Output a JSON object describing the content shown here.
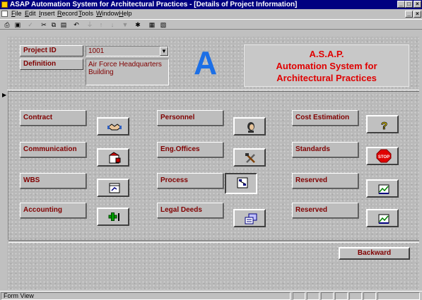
{
  "window": {
    "title": "ASAP Automation System for Architectural Practices - [Details of Project Information]",
    "min_glyph": "_",
    "max_glyph": "□",
    "close_glyph": "×"
  },
  "menu": [
    "File",
    "Edit",
    "Insert",
    "Record",
    "Tools",
    "Window",
    "Help"
  ],
  "toolbar": {
    "buttons": [
      {
        "name": "print-icon",
        "glyph": "⎙"
      },
      {
        "name": "preview-icon",
        "glyph": "▣"
      },
      {
        "name": "spell-icon",
        "glyph": "✓"
      },
      {
        "name": "cut-icon",
        "glyph": "✂"
      },
      {
        "name": "copy-icon",
        "glyph": "⧉"
      },
      {
        "name": "paste-icon",
        "glyph": "▤"
      },
      {
        "name": "undo-icon",
        "glyph": "↶"
      },
      {
        "name": "filter-icon",
        "glyph": "⏚"
      },
      {
        "name": "sort-asc-icon",
        "glyph": "↑"
      },
      {
        "name": "sort-desc-icon",
        "glyph": "↓"
      },
      {
        "name": "apply-filter-icon",
        "glyph": "▼"
      },
      {
        "name": "new-record-icon",
        "glyph": "✱"
      },
      {
        "name": "database-icon",
        "glyph": "▦"
      },
      {
        "name": "new-object-icon",
        "glyph": "▧"
      }
    ]
  },
  "project": {
    "id_label": "Project ID",
    "id_value": "1001",
    "definition_label": "Definition",
    "definition_value": "Air Force Headquarters Building",
    "dropdown_glyph": "▼"
  },
  "logo": {
    "letter": "A"
  },
  "banner": {
    "line1": "A.S.A.P.",
    "line2": "Automation System for",
    "line3": "Architectural Practices"
  },
  "record_selector_glyph": "▶",
  "modules": {
    "contract": "Contract",
    "communication": "Communication",
    "wbs": "WBS",
    "accounting": "Accounting",
    "personnel": "Personnel",
    "eng_offices": "Eng.Offices",
    "process": "Process",
    "legal_deeds": "Legal Deeds",
    "cost_estimation": "Cost Estimation",
    "standards": "Standards",
    "reserved_1": "Reserved",
    "reserved_2": "Reserved"
  },
  "icons": {
    "stop_text": "STOP",
    "question_glyph": "?",
    "accounting_plus": "+"
  },
  "backward_label": "Backward",
  "status": {
    "text": "Form View"
  },
  "colors": {
    "accent": "#800000",
    "title": "#000080",
    "logo": "#1c6fe6",
    "banner_text": "#e00000"
  }
}
